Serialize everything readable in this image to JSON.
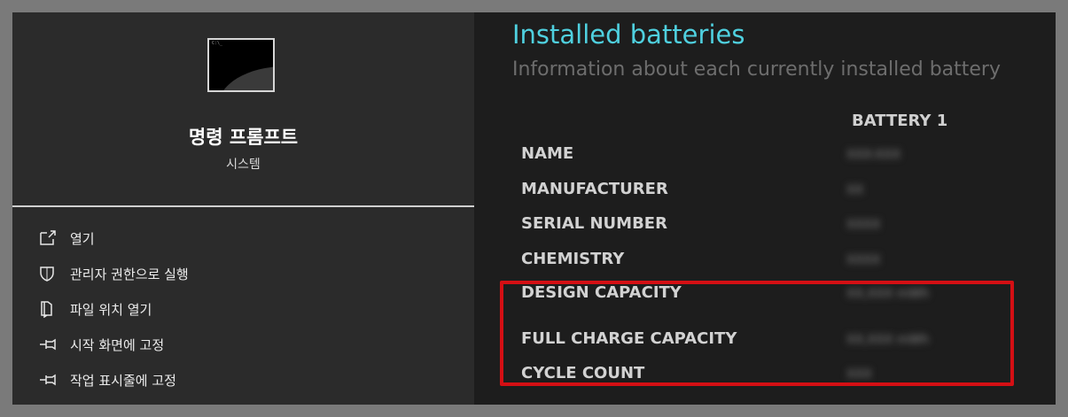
{
  "app": {
    "name": "명령 프롬프트",
    "category": "시스템",
    "icon": "command-prompt-icon"
  },
  "menu": [
    {
      "label": "열기",
      "icon": "open-icon"
    },
    {
      "label": "관리자 권한으로 실행",
      "icon": "shield-icon"
    },
    {
      "label": "파일 위치 열기",
      "icon": "folder-location-icon"
    },
    {
      "label": "시작 화면에 고정",
      "icon": "pin-icon"
    },
    {
      "label": "작업 표시줄에 고정",
      "icon": "pin-icon"
    }
  ],
  "report": {
    "title": "Installed batteries",
    "subtitle": "Information about each currently installed battery",
    "column_header": "BATTERY 1",
    "rows": [
      {
        "label": "NAME",
        "value": "XXX-XXX"
      },
      {
        "label": "MANUFACTURER",
        "value": "XX"
      },
      {
        "label": "SERIAL NUMBER",
        "value": "XXXX"
      },
      {
        "label": "CHEMISTRY",
        "value": "XXXX"
      },
      {
        "label": "DESIGN CAPACITY",
        "value": "XX,XXX mWh"
      },
      {
        "label": "FULL CHARGE CAPACITY",
        "value": "XX,XXX mWh"
      },
      {
        "label": "CYCLE COUNT",
        "value": "XXX"
      }
    ]
  },
  "colors": {
    "title_accent": "#4fd0df",
    "highlight": "#d40f14",
    "panel_left": "#2b2b2b",
    "panel_right": "#1d1d1d"
  }
}
